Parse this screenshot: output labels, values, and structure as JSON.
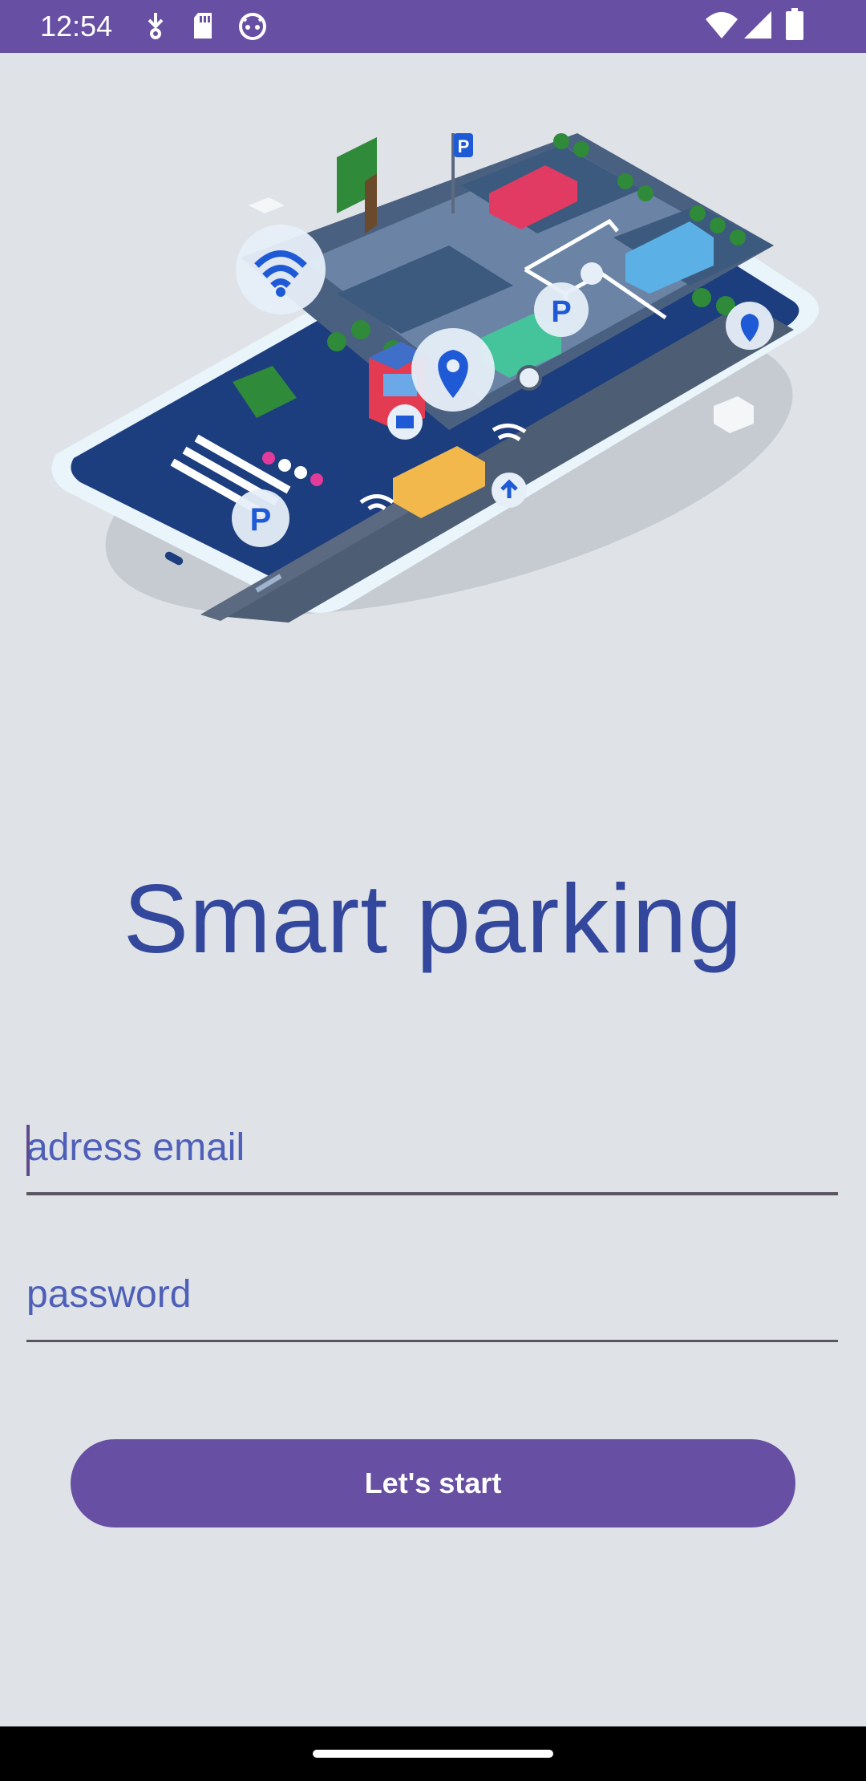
{
  "status_bar": {
    "time": "12:54",
    "left_icons": [
      "download-icon",
      "sd-card-icon",
      "debug-face-icon"
    ],
    "right_icons": [
      "wifi-icon",
      "signal-icon",
      "battery-icon"
    ]
  },
  "hero": {
    "icon": "smart-parking-illustration",
    "parking_sign": "P"
  },
  "title": "Smart parking",
  "form": {
    "email_placeholder": "adress email",
    "password_placeholder": "password",
    "start_label": "Let's start"
  },
  "colors": {
    "accent": "#674fa3",
    "title": "#33479d",
    "background": "#dfe3e7"
  }
}
